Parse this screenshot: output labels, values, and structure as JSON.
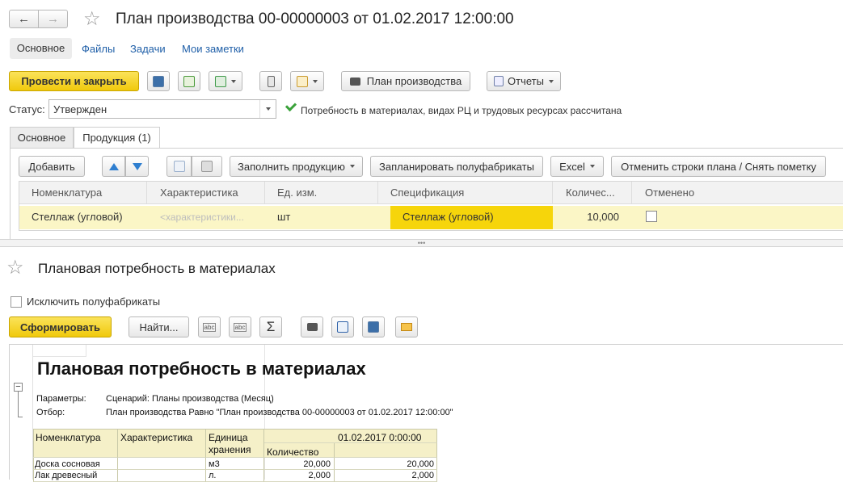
{
  "window": {
    "title": "План производства 00-00000003 от 01.02.2017 12:00:00",
    "back_icon": "←",
    "forward_icon": "→",
    "star_icon": "☆"
  },
  "nav_tabs": [
    "Основное",
    "Файлы",
    "Задачи",
    "Мои заметки"
  ],
  "toolbar": {
    "post_close_label": "Провести и закрыть",
    "plan_label": "План производства",
    "reports_label": "Отчеты"
  },
  "status": {
    "label": "Статус:",
    "value": "Утвержден",
    "message": "Потребность в материалах, видах РЦ и трудовых ресурсах рассчитана"
  },
  "doc_tabs": [
    "Основное",
    "Продукция (1)"
  ],
  "grid_toolbar": {
    "add_label": "Добавить",
    "fill_label": "Заполнить продукцию",
    "plan_semi_label": "Запланировать полуфабрикаты",
    "excel_label": "Excel",
    "cancel_rows_label": "Отменить строки плана / Снять пометку"
  },
  "grid": {
    "headers": [
      "Номенклатура",
      "Характеристика",
      "Ед. изм.",
      "Спецификация",
      "Количес...",
      "Отменено"
    ],
    "row": {
      "nomenclature": "Стеллаж (угловой)",
      "characteristic": "<характеристики...",
      "unit": "шт",
      "specification": "Стеллаж (угловой)",
      "quantity": "10,000",
      "cancelled": false
    }
  },
  "splitter": "•••",
  "report_panel": {
    "title": "Плановая потребность в материалах",
    "exclude_semi_label": "Исключить полуфабрикаты",
    "generate_label": "Сформировать",
    "find_label": "Найти...",
    "sum_icon": "Σ"
  },
  "report": {
    "heading": "Плановая потребность в материалах",
    "params_label": "Параметры:",
    "params_value": "Сценарий: Планы производства (Месяц)",
    "filter_label": "Отбор:",
    "filter_value": "План производства Равно \"План производства 00-00000003 от 01.02.2017 12:00:00\"",
    "collapse_icon": "−",
    "table_headers": {
      "nomenclature": "Номенклатура",
      "characteristic": "Характеристика",
      "unit_line1": "Единица",
      "unit_line2": "хранения",
      "quantity": "Количество",
      "date": "01.02.2017 0:00:00"
    },
    "rows": [
      {
        "name": "Доска сосновая",
        "unit": "м3",
        "qty": "20,000",
        "period": "20,000"
      },
      {
        "name": "Лак древесный",
        "unit": "л.",
        "qty": "2,000",
        "period": "2,000"
      }
    ]
  },
  "colors": {
    "accent_yellow": "#f4d21c",
    "row_highlight": "#fbf6c6",
    "link_blue": "#1f5fa8",
    "report_header": "#f5f0c8"
  }
}
